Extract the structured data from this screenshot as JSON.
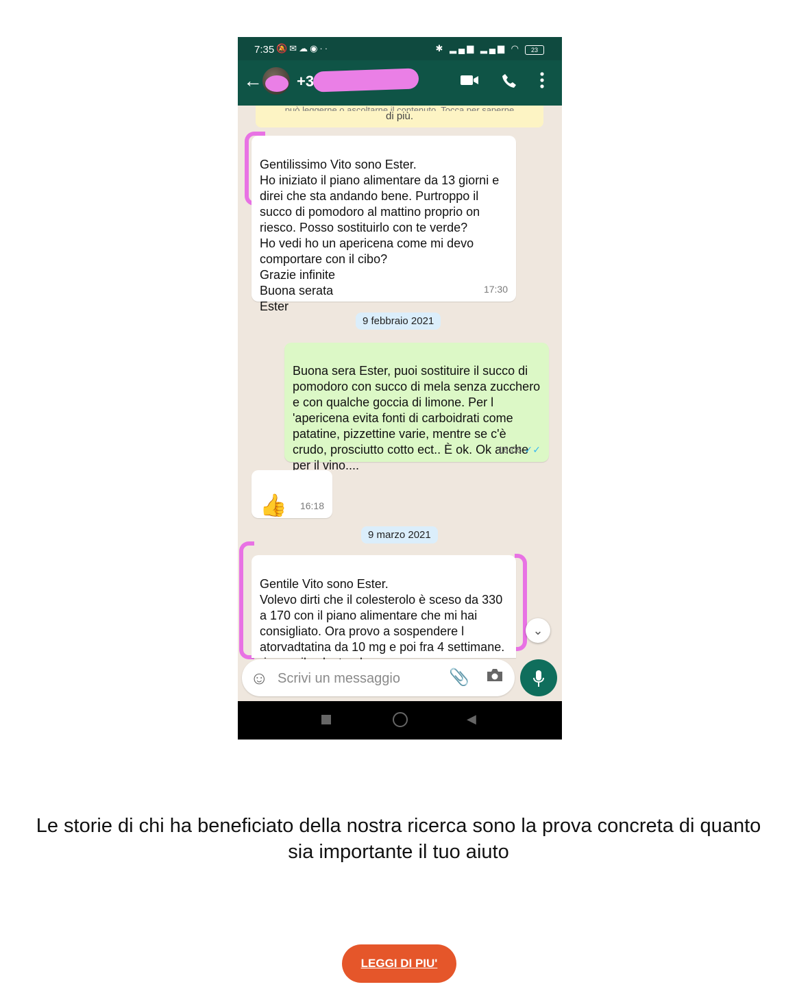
{
  "status_bar": {
    "time": "7:35",
    "battery": "23",
    "left_icons": [
      "muted-icon",
      "gmail-icon",
      "cloud-icon",
      "hotspot-icon",
      "more-dots-icon"
    ],
    "right_icons": [
      "bluetooth-icon",
      "signal-icon",
      "signal-icon",
      "wifi-icon",
      "battery-icon"
    ]
  },
  "header": {
    "contact_name": "+39",
    "icons": [
      "back-arrow-icon",
      "video-call-icon",
      "voice-call-icon",
      "overflow-menu-icon"
    ]
  },
  "chat": {
    "notice_partial": "può leggerne o ascoltarne il contenuto. Tocca per saperne",
    "notice_end": "di più.",
    "messages": [
      {
        "direction": "in",
        "text": "Gentilissimo Vito sono Ester.\nHo iniziato il piano alimentare da 13 giorni e direi che sta andando bene. Purtroppo il succo di pomodoro al mattino proprio on riesco. Posso sostituirlo con te verde?\nHo vedi ho un apericena come mi devo comportare con il cibo?\nGrazie infinite\nBuona serata\nEster",
        "time": "17:30"
      },
      {
        "direction": "out",
        "text": "Buona sera Ester, puoi sostituire il succo di pomodoro con succo di mela senza zucchero e con qualche goccia di limone. Per l 'apericena evita fonti di carboidrati come patatine, pizzettine varie, mentre se c'è crudo, prosciutto cotto ect.. È ok. Ok anche per il vino....",
        "time": "16:06",
        "ticks": "✓✓"
      },
      {
        "direction": "in",
        "text": "👍",
        "time": "16:18"
      },
      {
        "direction": "in",
        "text": "Gentile Vito sono Ester.\nVolevo dirti che   il colesterolo è sceso da 330 a 170 con il piano alimentare che mi hai consigliato. Ora provo a sospendere l atorvadtatina da 10 mg e poi fra 4 settimane. riprovo il colesterolo."
      }
    ],
    "date_separators": [
      "9 febbraio 2021",
      "9 marzo 2021"
    ],
    "highlight_color": "#e872e4"
  },
  "composer": {
    "placeholder": "Scrivi un messaggio",
    "icons": [
      "emoji-icon",
      "attach-icon",
      "camera-icon",
      "mic-icon"
    ]
  },
  "page": {
    "caption": "Le storie di chi ha beneficiato della nostra ricerca sono la prova concreta di quanto sia importante il tuo aiuto",
    "cta_label": "LEGGI DI PIU'",
    "cta_color": "#e5562a"
  }
}
